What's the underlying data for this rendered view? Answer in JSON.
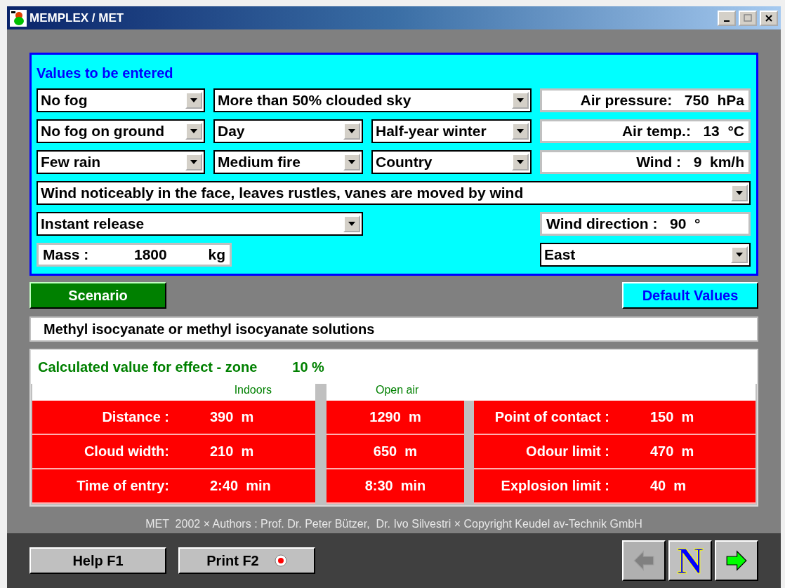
{
  "window": {
    "title": "MEMPLEX / MET"
  },
  "input_panel": {
    "title": "Values to be entered",
    "inputs": [
      {
        "kind": "dropdown",
        "value": "No fog"
      },
      {
        "kind": "dropdown",
        "value": "More than 50% clouded sky"
      },
      {
        "kind": "field",
        "label": "Air pressure:",
        "value": "750",
        "unit": "hPa"
      },
      {
        "kind": "dropdown",
        "value": "No fog on ground"
      },
      {
        "kind": "dropdown",
        "value": "Day"
      },
      {
        "kind": "dropdown",
        "value": "Half-year winter"
      },
      {
        "kind": "field",
        "label": "Air temp.:",
        "value": "13",
        "unit": "°C"
      },
      {
        "kind": "dropdown",
        "value": "Few rain"
      },
      {
        "kind": "dropdown",
        "value": "Medium fire"
      },
      {
        "kind": "dropdown",
        "value": "Country"
      },
      {
        "kind": "field",
        "label": "Wind :",
        "value": "9",
        "unit": "km/h"
      },
      {
        "kind": "dropdown",
        "value": "Wind noticeably in the face, leaves rustles, vanes are moved by wind"
      },
      {
        "kind": "dropdown",
        "value": "Instant release"
      },
      {
        "kind": "field",
        "label": "Wind direction :",
        "value": "90",
        "unit": "°"
      },
      {
        "kind": "field",
        "label": "Mass :",
        "value": "1800",
        "unit": "kg"
      },
      {
        "kind": "dropdown",
        "value": "East"
      }
    ]
  },
  "scenario_button": "Scenario",
  "default_values_button": "Default Values",
  "substance": "Methyl isocyanate or methyl isocyanate solutions",
  "results": {
    "title": "Calculated value for effect - zone",
    "value": "10 %",
    "headers": [
      "Indoors",
      "Open air"
    ],
    "rows": [
      {
        "label": "Distance :",
        "indoors": "390  m",
        "open_air": "1290  m",
        "limit_label": "Point of contact :",
        "limit_value": "150  m"
      },
      {
        "label": "Cloud width:",
        "indoors": "210  m",
        "open_air": "650  m",
        "limit_label": "Odour limit :",
        "limit_value": "470  m"
      },
      {
        "label": "Time of entry:",
        "indoors": "2:40  min",
        "open_air": "8:30  min",
        "limit_label": "Explosion limit :",
        "limit_value": "40  m"
      }
    ]
  },
  "footer": "MET  2002 × Authors : Prof. Dr. Peter Bützer,  Dr. Ivo Silvestri × Copyright Keudel av-Technik GmbH",
  "buttons": [
    "Help F1",
    "Print F2"
  ],
  "nav_buttons": [
    {
      "kind": "back",
      "disabled": true
    },
    {
      "kind": "letter",
      "label": "N",
      "disabled": false
    },
    {
      "kind": "next",
      "disabled": false
    }
  ]
}
